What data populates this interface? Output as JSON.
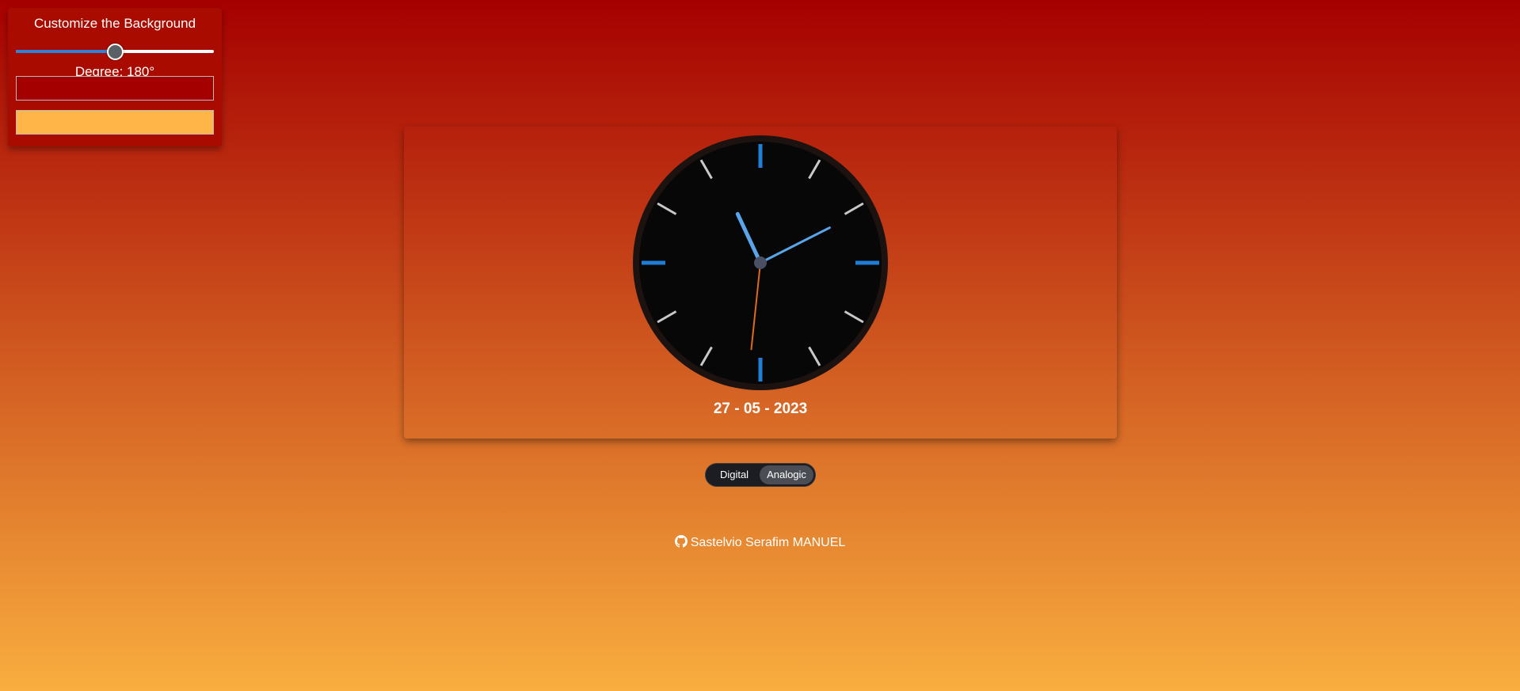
{
  "panel": {
    "title": "Customize the Background",
    "slider_percent": 50,
    "degree_text": "Degree: 180°",
    "color_1": "#a50000",
    "color_2": "#ffb547"
  },
  "clock": {
    "hour": 11,
    "minute": 10,
    "second": 31,
    "face_color": "#070707",
    "rim_color": "#1c1310",
    "tick_major_color": "#1f7fd6",
    "tick_minor_color": "#c8c8c8",
    "hand_color": "#5aa5ea",
    "second_hand_color": "#e06a18"
  },
  "date_text": "27 - 05 - 2023",
  "toggle": {
    "digital_label": "Digital",
    "analogic_label": "Analogic"
  },
  "footer": {
    "author": "Sastelvio Serafim MANUEL",
    "icon": "github-icon"
  }
}
